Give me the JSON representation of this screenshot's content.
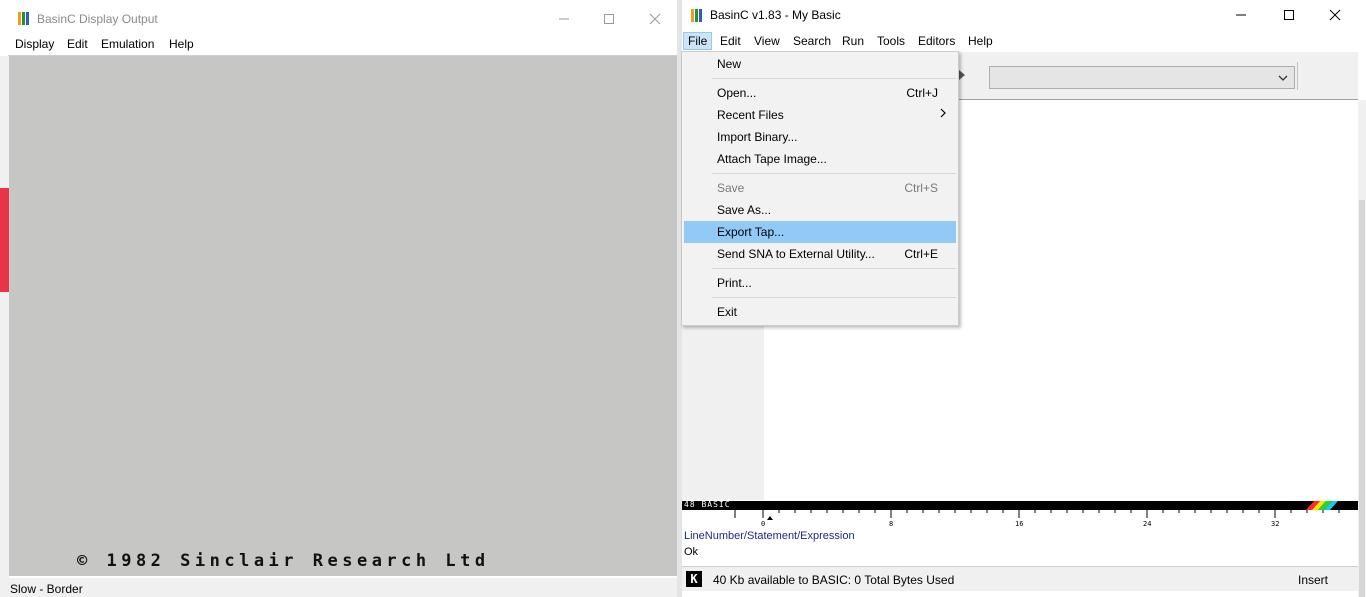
{
  "left_window": {
    "title": "BasinC Display Output",
    "menu": [
      "Display",
      "Edit",
      "Emulation",
      "Help"
    ],
    "screen_text": "© 1982 Sinclair Research Ltd",
    "status": "Slow - Border"
  },
  "right_window": {
    "title": "BasinC v1.83 - My Basic",
    "menu": [
      "File",
      "Edit",
      "View",
      "Search",
      "Run",
      "Tools",
      "Editors",
      "Help"
    ],
    "ruler_label": "48 BASIC",
    "ruler_ticks": [
      "0",
      "8",
      "16",
      "24",
      "32"
    ],
    "prompt_label": "LineNumber/Statement/Expression",
    "ok_text": "Ok",
    "status_icon_letter": "K",
    "status_text": "40 Kb available to BASIC: 0 Total Bytes Used",
    "insert_mode": "Insert"
  },
  "file_menu": {
    "items": [
      {
        "label": "New",
        "shortcut": ""
      },
      {
        "label": "Open...",
        "shortcut": "Ctrl+J"
      },
      {
        "label": "Recent Files",
        "shortcut": ""
      },
      {
        "label": "Import Binary...",
        "shortcut": ""
      },
      {
        "label": "Attach Tape Image...",
        "shortcut": ""
      },
      {
        "label": "Save",
        "shortcut": "Ctrl+S"
      },
      {
        "label": "Save As...",
        "shortcut": ""
      },
      {
        "label": "Export Tap...",
        "shortcut": ""
      },
      {
        "label": "Send SNA to External Utility...",
        "shortcut": "Ctrl+E"
      },
      {
        "label": "Print...",
        "shortcut": ""
      },
      {
        "label": "Exit",
        "shortcut": ""
      }
    ],
    "highlighted": "Export Tap...",
    "disabled": [
      "Save"
    ]
  },
  "colors": {
    "spectrum_paper": "#c6c7c5",
    "highlight": "#91c9f7",
    "prompt_text": "#1a2a8a",
    "stripe_red": "#ff2a2a",
    "stripe_yellow": "#ffe400",
    "stripe_green": "#2bd52b",
    "stripe_cyan": "#1ec8e8"
  },
  "icons": [
    "basinc-app-icon",
    "minimize-icon",
    "maximize-icon",
    "close-icon",
    "chevron-down-icon",
    "submenu-arrow-icon",
    "k-cursor-icon"
  ]
}
